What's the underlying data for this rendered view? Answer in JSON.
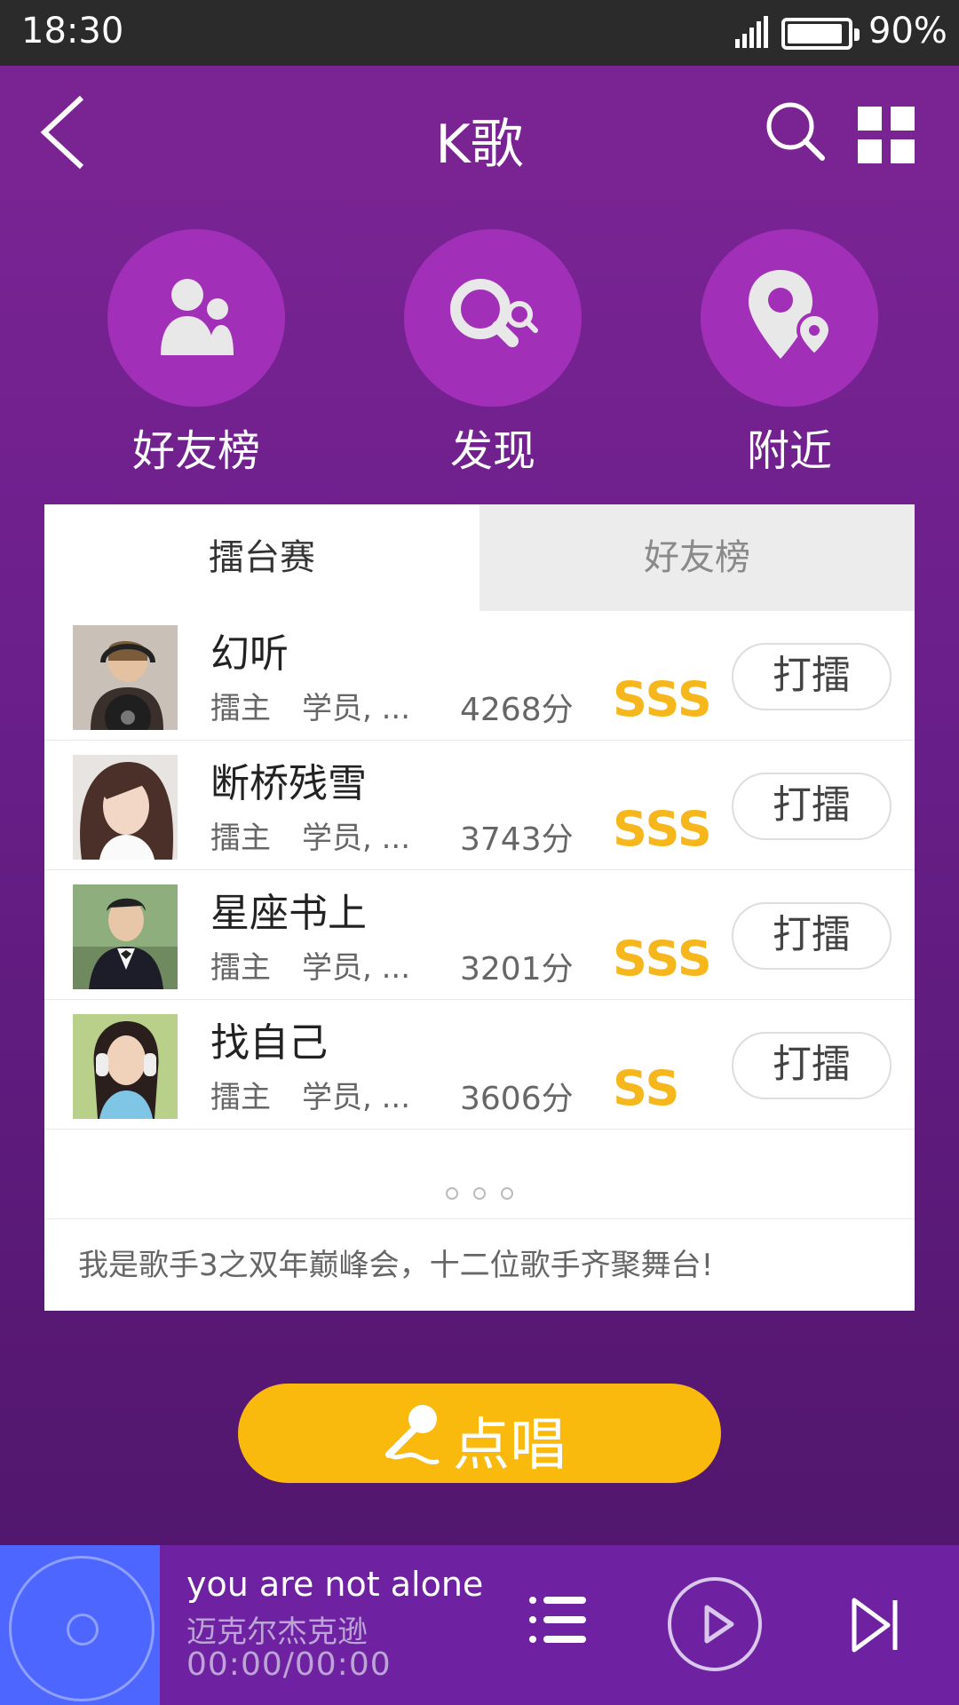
{
  "status_bar": {
    "time": "18:30",
    "battery": "90%"
  },
  "header": {
    "title": "K歌"
  },
  "quick_actions": [
    {
      "label": "好友榜",
      "icon": "friends-icon"
    },
    {
      "label": "发现",
      "icon": "discover-search-icon"
    },
    {
      "label": "附近",
      "icon": "location-pins-icon"
    }
  ],
  "tabs": {
    "active": "擂台赛",
    "inactive": "好友榜"
  },
  "list": [
    {
      "name": "幻听",
      "role": "擂主",
      "meta": "学员, ...",
      "score": "4268分",
      "grade": "SSS",
      "action": "打擂"
    },
    {
      "name": "断桥残雪",
      "role": "擂主",
      "meta": "学员, ...",
      "score": "3743分",
      "grade": "SSS",
      "action": "打擂"
    },
    {
      "name": "星座书上",
      "role": "擂主",
      "meta": "学员, ...",
      "score": "3201分",
      "grade": "SSS",
      "action": "打擂"
    },
    {
      "name": "找自己",
      "role": "擂主",
      "meta": "学员, ...",
      "score": "3606分",
      "grade": "SS",
      "action": "打擂"
    }
  ],
  "notice": "我是歌手3之双年巅峰会，十二位歌手齐聚舞台!",
  "sing_button": "点唱",
  "player": {
    "title": "you are not alone",
    "artist": "迈克尔杰克逊",
    "time": "00:00/00:00"
  },
  "colors": {
    "accent": "#f9b90d",
    "grade": "#f5b71c",
    "primary": "#7a2392",
    "player_disc": "#4d66ff"
  }
}
